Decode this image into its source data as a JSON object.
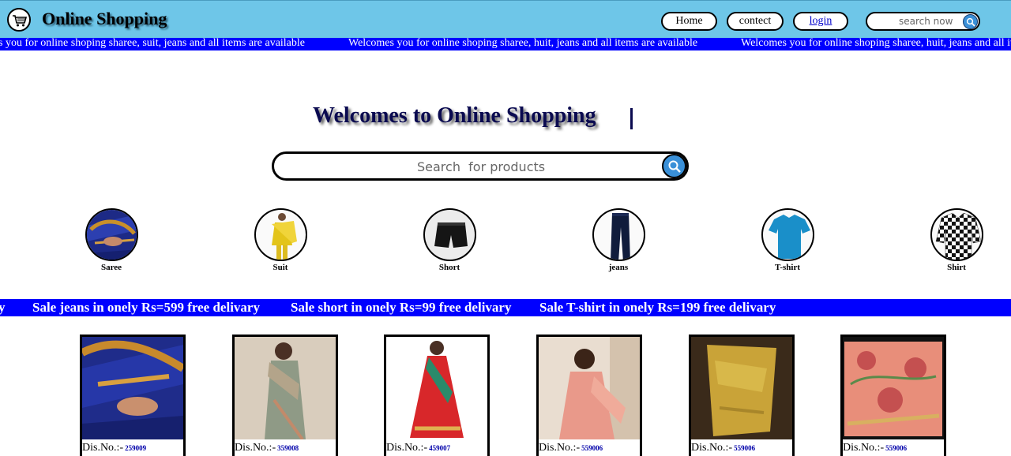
{
  "header": {
    "brand": "Online Shopping",
    "nav": {
      "home": "Home",
      "contect": "contect",
      "login": "login"
    },
    "search_placeholder": "search now"
  },
  "marquee_top": {
    "segments": [
      "s you for online shoping sharee, suit, jeans and all items are available",
      "Welcomes you for online shoping sharee, huit, jeans and all items are available",
      "Welcomes you for online shoping sharee, huit, jeans and all items are available"
    ]
  },
  "hero": {
    "title": "Welcomes to Online Shopping",
    "search_placeholder": "Search  for products"
  },
  "categories": [
    {
      "label": "Saree",
      "icon": "saree-image"
    },
    {
      "label": "Suit",
      "icon": "suit-image"
    },
    {
      "label": "Short",
      "icon": "short-image"
    },
    {
      "label": "jeans",
      "icon": "jeans-image"
    },
    {
      "label": "T-shirt",
      "icon": "tshirt-image"
    },
    {
      "label": "Shirt",
      "icon": "shirt-image"
    }
  ],
  "marquee_sale": {
    "segments": [
      "y",
      "Sale jeans in onely Rs=599 free delivary",
      "Sale short in onely Rs=99 free delivary",
      "Sale T-shirt in onely Rs=199 free delivary"
    ]
  },
  "products": [
    {
      "dis_label": "Dis.No.:-",
      "dis_no": "259009"
    },
    {
      "dis_label": "Dis.No.:-",
      "dis_no": "359008"
    },
    {
      "dis_label": "Dis.No.:-",
      "dis_no": "459007"
    },
    {
      "dis_label": "Dis.No.:-",
      "dis_no": "559006"
    },
    {
      "dis_label": "Dis.No.:-",
      "dis_no": "559006"
    },
    {
      "dis_label": "Dis.No.:-",
      "dis_no": "559006"
    }
  ],
  "colors": {
    "header_bg": "#6ec6e8",
    "marquee_bg": "#0000ff",
    "accent_blue": "#3a90d8"
  }
}
